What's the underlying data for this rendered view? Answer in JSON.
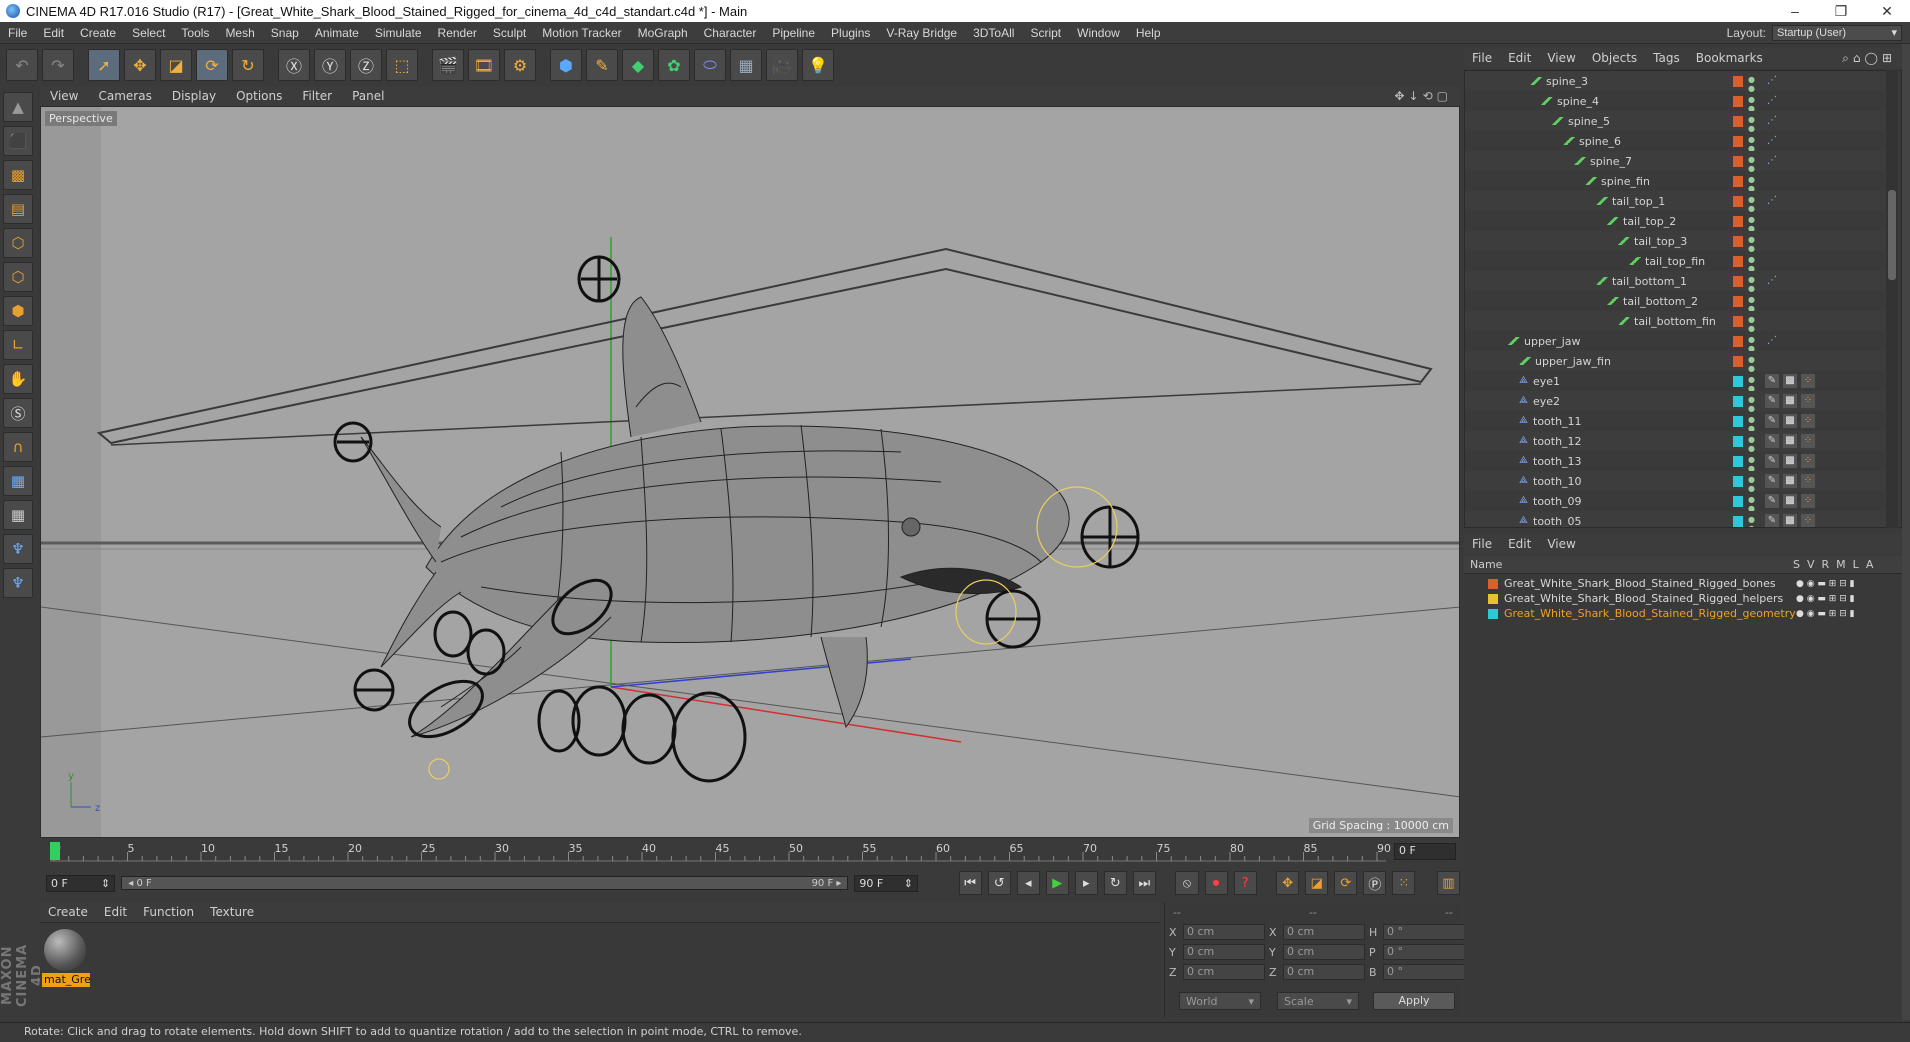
{
  "window": {
    "title": "CINEMA 4D R17.016 Studio (R17) - [Great_White_Shark_Blood_Stained_Rigged_for_cinema_4d_c4d_standart.c4d *] - Main",
    "minimize": "–",
    "restore": "❐",
    "close": "✕"
  },
  "menubar": {
    "items": [
      "File",
      "Edit",
      "Create",
      "Select",
      "Tools",
      "Mesh",
      "Snap",
      "Animate",
      "Simulate",
      "Render",
      "Sculpt",
      "Motion Tracker",
      "MoGraph",
      "Character",
      "Pipeline",
      "Plugins",
      "V-Ray Bridge",
      "3DToAll",
      "Script",
      "Window",
      "Help"
    ],
    "layout_label": "Layout:",
    "layout_value": "Startup (User)"
  },
  "viewport": {
    "menu": [
      "View",
      "Cameras",
      "Display",
      "Options",
      "Filter",
      "Panel"
    ],
    "label": "Perspective",
    "grid_spacing": "Grid Spacing : 10000 cm"
  },
  "timeline": {
    "ticks": [
      "0",
      "5",
      "10",
      "15",
      "20",
      "25",
      "30",
      "35",
      "40",
      "45",
      "50",
      "55",
      "60",
      "65",
      "70",
      "75",
      "80",
      "85",
      "90"
    ],
    "current_frame": "0 F",
    "start_field": "0 F",
    "range_start": "◂ 0 F",
    "range_end": "90 F ▸",
    "end_field": "90 F"
  },
  "material_manager": {
    "menu": [
      "Create",
      "Edit",
      "Function",
      "Texture"
    ],
    "material_name": "mat_Gre"
  },
  "coordinates": {
    "headers": [
      "--",
      "--",
      "--"
    ],
    "rows": [
      {
        "a_label": "X",
        "a_val": "0 cm",
        "b_label": "X",
        "b_val": "0 cm",
        "c_label": "H",
        "c_val": "0 °"
      },
      {
        "a_label": "Y",
        "a_val": "0 cm",
        "b_label": "Y",
        "b_val": "0 cm",
        "c_label": "P",
        "c_val": "0 °"
      },
      {
        "a_label": "Z",
        "a_val": "0 cm",
        "b_label": "Z",
        "b_val": "0 cm",
        "c_label": "B",
        "c_val": "0 °"
      }
    ],
    "space": "World",
    "mode": "Scale",
    "apply": "Apply"
  },
  "object_manager": {
    "menu": [
      "File",
      "Edit",
      "View",
      "Objects",
      "Tags",
      "Bookmarks"
    ],
    "items": [
      {
        "name": "spine_3",
        "depth": 5,
        "kind": "bone",
        "layer": "#d8602a",
        "tag": "ik"
      },
      {
        "name": "spine_4",
        "depth": 6,
        "kind": "bone",
        "layer": "#d8602a",
        "tag": "ik"
      },
      {
        "name": "spine_5",
        "depth": 7,
        "kind": "bone",
        "layer": "#d8602a",
        "tag": "ik"
      },
      {
        "name": "spine_6",
        "depth": 8,
        "kind": "bone",
        "layer": "#d8602a",
        "tag": "ik"
      },
      {
        "name": "spine_7",
        "depth": 9,
        "kind": "bone",
        "layer": "#d8602a",
        "tag": "ik"
      },
      {
        "name": "spine_fin",
        "depth": 10,
        "kind": "bone",
        "layer": "#d8602a",
        "tag": ""
      },
      {
        "name": "tail_top_1",
        "depth": 11,
        "kind": "bone",
        "layer": "#d8602a",
        "tag": "ik"
      },
      {
        "name": "tail_top_2",
        "depth": 12,
        "kind": "bone",
        "layer": "#d8602a",
        "tag": ""
      },
      {
        "name": "tail_top_3",
        "depth": 13,
        "kind": "bone",
        "layer": "#d8602a",
        "tag": ""
      },
      {
        "name": "tail_top_fin",
        "depth": 14,
        "kind": "bone",
        "layer": "#d8602a",
        "tag": ""
      },
      {
        "name": "tail_bottom_1",
        "depth": 11,
        "kind": "bone",
        "layer": "#d8602a",
        "tag": "ik"
      },
      {
        "name": "tail_bottom_2",
        "depth": 12,
        "kind": "bone",
        "layer": "#d8602a",
        "tag": ""
      },
      {
        "name": "tail_bottom_fin",
        "depth": 13,
        "kind": "bone",
        "layer": "#d8602a",
        "tag": ""
      },
      {
        "name": "upper_jaw",
        "depth": 3,
        "kind": "bone",
        "layer": "#d8602a",
        "tag": "ik"
      },
      {
        "name": "upper_jaw_fin",
        "depth": 4,
        "kind": "bone",
        "layer": "#d8602a",
        "tag": ""
      },
      {
        "name": "eye1",
        "depth": 4,
        "kind": "joint",
        "layer": "#2ec8d8",
        "tag": "mat"
      },
      {
        "name": "eye2",
        "depth": 4,
        "kind": "joint",
        "layer": "#2ec8d8",
        "tag": "mat"
      },
      {
        "name": "tooth_11",
        "depth": 4,
        "kind": "joint",
        "layer": "#2ec8d8",
        "tag": "mat"
      },
      {
        "name": "tooth_12",
        "depth": 4,
        "kind": "joint",
        "layer": "#2ec8d8",
        "tag": "mat"
      },
      {
        "name": "tooth_13",
        "depth": 4,
        "kind": "joint",
        "layer": "#2ec8d8",
        "tag": "mat"
      },
      {
        "name": "tooth_10",
        "depth": 4,
        "kind": "joint",
        "layer": "#2ec8d8",
        "tag": "mat"
      },
      {
        "name": "tooth_09",
        "depth": 4,
        "kind": "joint",
        "layer": "#2ec8d8",
        "tag": "mat"
      },
      {
        "name": "tooth_05",
        "depth": 4,
        "kind": "joint",
        "layer": "#2ec8d8",
        "tag": "mat"
      }
    ]
  },
  "layer_manager": {
    "menu": [
      "File",
      "Edit",
      "View"
    ],
    "name_header": "Name",
    "col_headers": [
      "S",
      "V",
      "R",
      "M",
      "L",
      "A"
    ],
    "layers": [
      {
        "name": "Great_White_Shark_Blood_Stained_Rigged_bones",
        "color": "#d8602a",
        "text_color": "#d8d8d8"
      },
      {
        "name": "Great_White_Shark_Blood_Stained_Rigged_helpers",
        "color": "#e8c030",
        "text_color": "#d8d8d8"
      },
      {
        "name": "Great_White_Shark_Blood_Stained_Rigged_geometry",
        "color": "#2ec8d8",
        "text_color": "#f0a020"
      }
    ]
  },
  "status": "Rotate: Click and drag to rotate elements. Hold down SHIFT to add to quantize rotation / add to the selection in point mode, CTRL to remove.",
  "brand": "MAXON CINEMA 4D"
}
